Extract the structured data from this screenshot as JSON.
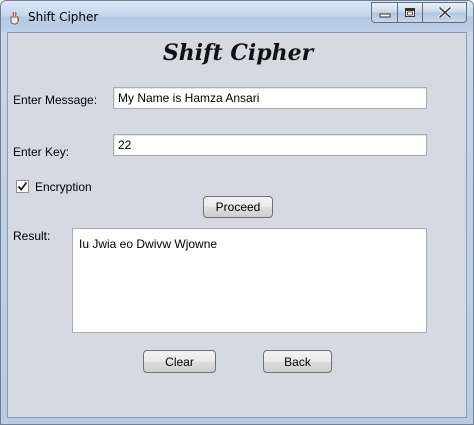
{
  "window": {
    "title": "Shift Cipher",
    "icon": "java-cup-icon",
    "controls": [
      "minimize-icon",
      "maximize-icon",
      "close-icon"
    ]
  },
  "heading": "Shift Cipher",
  "message": {
    "label": "Enter Message:",
    "value": "My Name is Hamza Ansari"
  },
  "key": {
    "label": "Enter Key:",
    "value": "22"
  },
  "encryption": {
    "label": "Encryption",
    "checked": true
  },
  "proceed_label": "Proceed",
  "result": {
    "label": "Result:",
    "value": "Iu Jwia eo Dwivw Wjowne"
  },
  "buttons": {
    "clear": "Clear",
    "back": "Back"
  }
}
